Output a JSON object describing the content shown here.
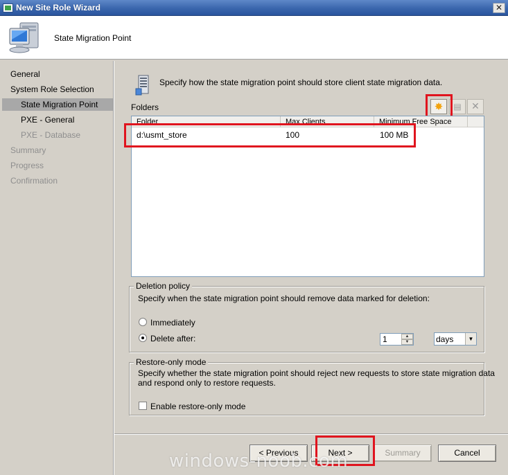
{
  "window": {
    "title": "New Site Role Wizard",
    "close_glyph": "✕"
  },
  "header": {
    "title": "State Migration Point",
    "icon": "computer-icon"
  },
  "nav": {
    "items": [
      {
        "label": "General"
      },
      {
        "label": "System Role Selection"
      },
      {
        "label": "State Migration Point"
      },
      {
        "label": "PXE - General"
      },
      {
        "label": "PXE - Database"
      },
      {
        "label": "Summary"
      },
      {
        "label": "Progress"
      },
      {
        "label": "Confirmation"
      }
    ]
  },
  "main": {
    "intro_text": "Specify how the state migration point should store client state migration data.",
    "folders_label": "Folders",
    "toolbar": {
      "new_icon": "new-star-icon",
      "properties_icon": "properties-icon",
      "delete_icon": "delete-icon"
    },
    "table": {
      "columns": [
        "Folder",
        "Max Clients",
        "Minimum Free Space"
      ],
      "rows": [
        {
          "folder": "d:\\usmt_store",
          "max_clients": "100",
          "min_free_space": "100 MB"
        }
      ]
    },
    "deletion_policy": {
      "title": "Deletion policy",
      "description": "Specify when the state migration point should remove data marked for deletion:",
      "immediately_label": "Immediately",
      "delete_after_label": "Delete after:",
      "selected": "delete_after",
      "delete_after_value": "1",
      "unit_value": "days"
    },
    "restore_only": {
      "title": "Restore-only mode",
      "description_line1": "Specify whether the state migration point should reject new requests to store state migration data",
      "description_line2": "and respond only to restore requests.",
      "checkbox_label": "Enable restore-only mode",
      "checked": false
    }
  },
  "buttons": {
    "previous": "< Previous",
    "next": "Next >",
    "summary": "Summary",
    "cancel": "Cancel"
  },
  "watermark": "windows-noob.com",
  "colors": {
    "highlight_box": "#e0141e",
    "title_bar": "#3a66ad"
  }
}
